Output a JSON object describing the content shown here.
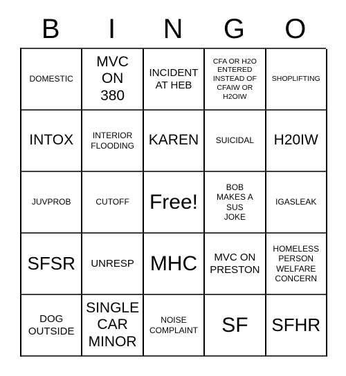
{
  "card": {
    "header_letters": [
      "B",
      "I",
      "N",
      "G",
      "O"
    ],
    "rows": [
      [
        {
          "text": "DOMESTIC",
          "size": "s"
        },
        {
          "text": "MVC\nON\n380",
          "size": "l"
        },
        {
          "text": "INCIDENT\nAT HEB",
          "size": "m"
        },
        {
          "text": "CFA OR H2O\nENTERED\nINSTEAD OF\nCFAIW OR\nH2OIW",
          "size": "xs"
        },
        {
          "text": "SHOPLIFTING",
          "size": "xs"
        }
      ],
      [
        {
          "text": "INTOX",
          "size": "l"
        },
        {
          "text": "INTERIOR\nFLOODING",
          "size": "s"
        },
        {
          "text": "KAREN",
          "size": "l"
        },
        {
          "text": "SUICIDAL",
          "size": "s"
        },
        {
          "text": "H20IW",
          "size": "l"
        }
      ],
      [
        {
          "text": "JUVPROB",
          "size": "s"
        },
        {
          "text": "CUTOFF",
          "size": "s"
        },
        {
          "text": "Free!",
          "size": "xxl"
        },
        {
          "text": "BOB\nMAKES A\nSUS\nJOKE",
          "size": "s"
        },
        {
          "text": "IGASLEAK",
          "size": "s"
        }
      ],
      [
        {
          "text": "SFSR",
          "size": "xl"
        },
        {
          "text": "UNRESP",
          "size": "m"
        },
        {
          "text": "MHC",
          "size": "xxl"
        },
        {
          "text": "MVC ON\nPRESTON",
          "size": "m"
        },
        {
          "text": "HOMELESS\nPERSON\nWELFARE\nCONCERN",
          "size": "s"
        }
      ],
      [
        {
          "text": "DOG\nOUTSIDE",
          "size": "m"
        },
        {
          "text": "SINGLE\nCAR\nMINOR",
          "size": "l"
        },
        {
          "text": "NOISE\nCOMPLAINT",
          "size": "s"
        },
        {
          "text": "SF",
          "size": "xxl"
        },
        {
          "text": "SFHR",
          "size": "xl"
        }
      ]
    ]
  }
}
